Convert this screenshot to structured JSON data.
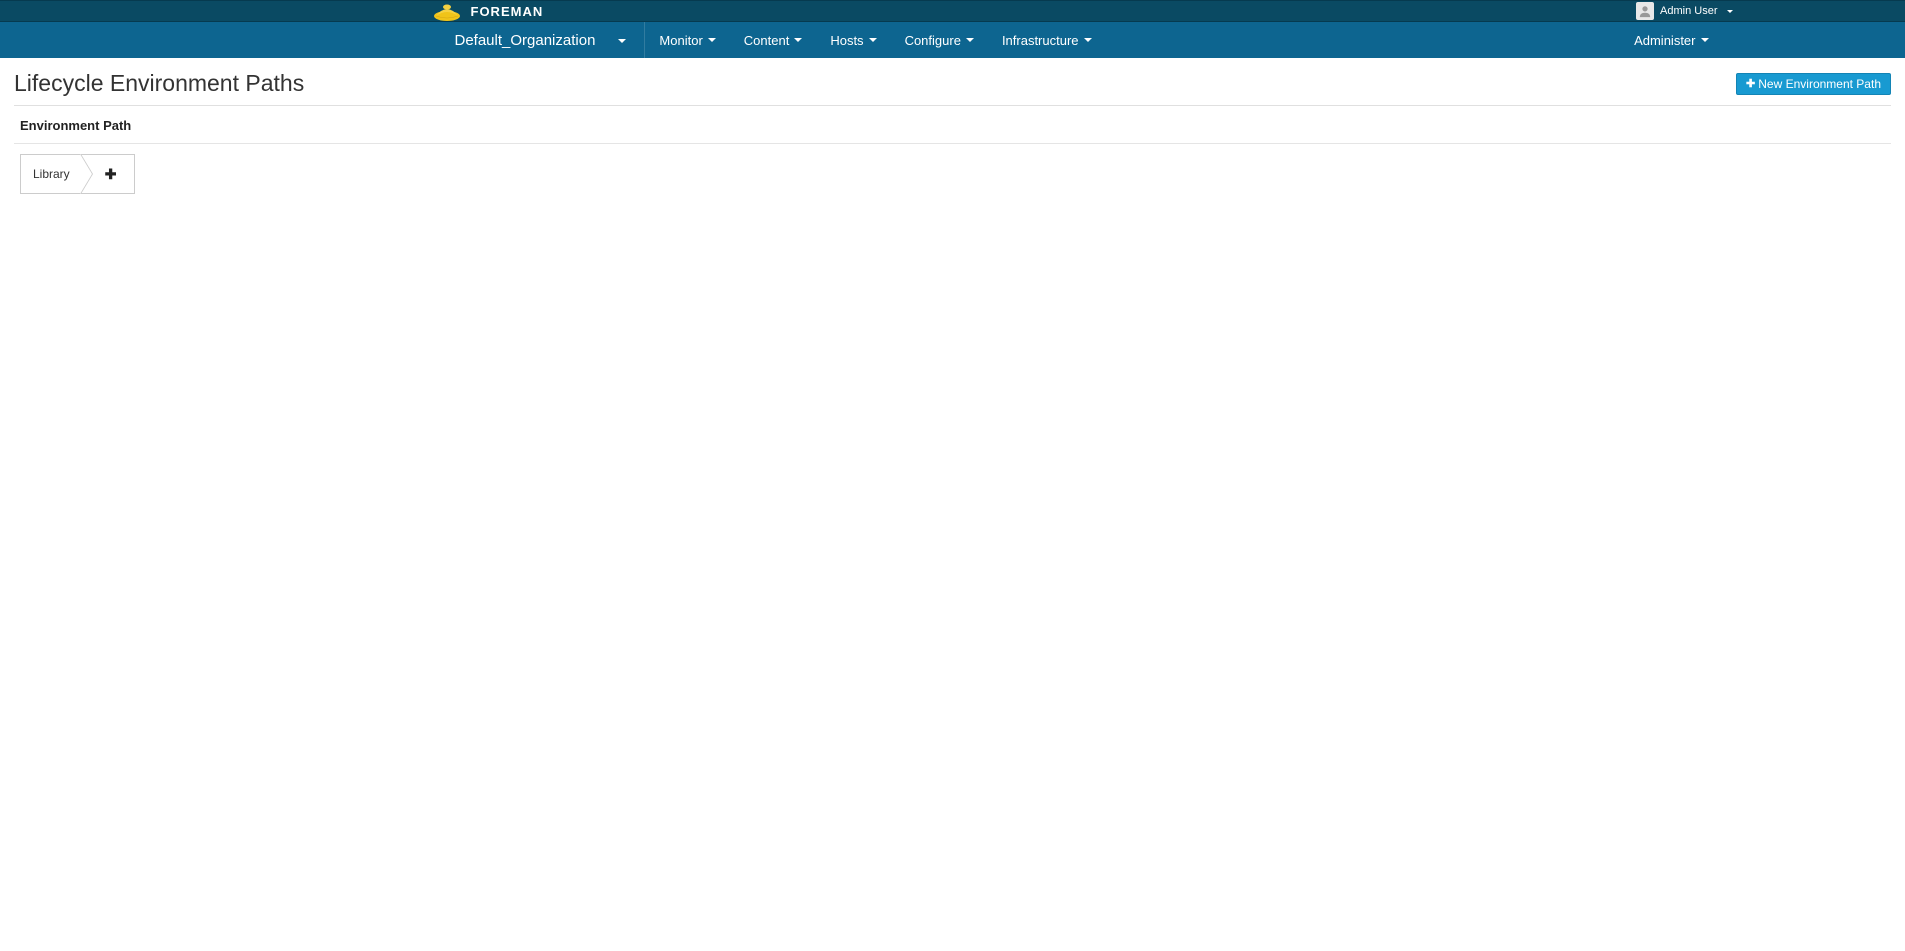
{
  "brand": {
    "name": "FOREMAN"
  },
  "topbar": {
    "user_label": "Admin User"
  },
  "navbar": {
    "organization": "Default_Organization",
    "menu": [
      {
        "label": "Monitor"
      },
      {
        "label": "Content"
      },
      {
        "label": "Hosts"
      },
      {
        "label": "Configure"
      },
      {
        "label": "Infrastructure"
      }
    ],
    "right_menu": [
      {
        "label": "Administer"
      }
    ]
  },
  "page": {
    "title": "Lifecycle Environment Paths",
    "new_button_label": "New Environment Path",
    "subheader": "Environment Path"
  },
  "env_path": {
    "segments": [
      {
        "label": "Library"
      }
    ],
    "add_label": "+"
  }
}
